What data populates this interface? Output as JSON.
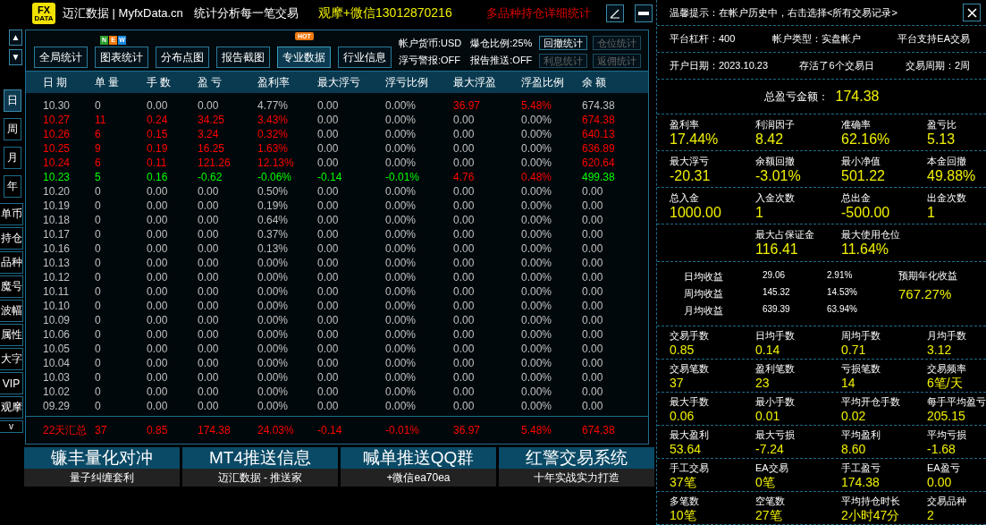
{
  "title_bar": {
    "logo_top": "FX",
    "logo_bottom": "DATA",
    "brand": "迈汇数据 | MyfxData.cn",
    "slogan": "统计分析每一笔交易",
    "contact": "观摩+微信13012870216",
    "promo": "多品种持仓详细统计"
  },
  "nav_arrows": [
    "▲",
    "▼"
  ],
  "side_tabs": [
    {
      "label": "日",
      "kind": "period",
      "selected": true
    },
    {
      "label": "周",
      "kind": "period",
      "selected": false
    },
    {
      "label": "月",
      "kind": "period",
      "selected": false
    },
    {
      "label": "年",
      "kind": "period",
      "selected": false
    },
    {
      "label": "单币",
      "kind": "view",
      "selected": false
    },
    {
      "label": "持仓",
      "kind": "view",
      "selected": false
    },
    {
      "label": "品种",
      "kind": "view",
      "selected": false
    },
    {
      "label": "魔号",
      "kind": "view",
      "selected": false
    },
    {
      "label": "波幅",
      "kind": "view",
      "selected": false
    },
    {
      "label": "属性",
      "kind": "view",
      "selected": false
    },
    {
      "label": "大字",
      "kind": "view",
      "selected": false
    },
    {
      "label": "VIP",
      "kind": "view",
      "selected": false
    },
    {
      "label": "观摩",
      "kind": "view",
      "selected": false
    },
    {
      "label": "v",
      "kind": "more",
      "selected": false
    }
  ],
  "toolbar": {
    "buttons": [
      {
        "label": "全局统计",
        "selected": false
      },
      {
        "label": "图表统计",
        "selected": false,
        "badge": {
          "kind": "letters",
          "letters": [
            {
              "text": "N",
              "color": "#2e9e2e"
            },
            {
              "text": "E",
              "color": "#f07a10"
            },
            {
              "text": "W",
              "color": "#1a8ae0"
            }
          ]
        }
      },
      {
        "label": "分布点图",
        "selected": false
      },
      {
        "label": "报告截图",
        "selected": false
      },
      {
        "label": "专业数据",
        "selected": true,
        "badge": {
          "kind": "hot",
          "text": "HOT"
        }
      },
      {
        "label": "行业信息",
        "selected": false
      }
    ],
    "info": [
      "帐户货币:USD",
      "爆仓比例:25%",
      "浮亏警报:OFF",
      "报告推送:OFF"
    ],
    "small_buttons": [
      {
        "label": "回撤统计",
        "disabled": false
      },
      {
        "label": "仓位统计",
        "disabled": true
      },
      {
        "label": "利息统计",
        "disabled": true
      },
      {
        "label": "返佣统计",
        "disabled": true
      }
    ]
  },
  "table": {
    "columns": [
      "日 期",
      "单 量",
      "手 数",
      "盈 亏",
      "盈利率",
      "最大浮亏",
      "浮亏比例",
      "最大浮盈",
      "浮盈比例",
      "余 额"
    ],
    "rows": [
      {
        "cells": [
          {
            "text": "10.30",
            "color": "#c0c0c0"
          },
          {
            "text": "0",
            "color": "#c0c0c0"
          },
          {
            "text": "0.00",
            "color": "#c0c0c0"
          },
          {
            "text": "0.00",
            "color": "#c0c0c0"
          },
          {
            "text": "4.77%",
            "color": "#c0c0c0"
          },
          {
            "text": "0.00",
            "color": "#c0c0c0"
          },
          {
            "text": "0.00%",
            "color": "#c0c0c0"
          },
          {
            "text": "36.97",
            "color": "#ff0000"
          },
          {
            "text": "5.48%",
            "color": "#ff0000"
          },
          {
            "text": "674.38",
            "color": "#c0c0c0"
          }
        ]
      },
      {
        "cells": [
          {
            "text": "10.27",
            "color": "#ff0000"
          },
          {
            "text": "11",
            "color": "#ff0000"
          },
          {
            "text": "0.24",
            "color": "#ff0000"
          },
          {
            "text": "34.25",
            "color": "#ff0000"
          },
          {
            "text": "3.43%",
            "color": "#ff0000"
          },
          {
            "text": "0.00",
            "color": "#c0c0c0"
          },
          {
            "text": "0.00%",
            "color": "#c0c0c0"
          },
          {
            "text": "0.00",
            "color": "#c0c0c0"
          },
          {
            "text": "0.00%",
            "color": "#c0c0c0"
          },
          {
            "text": "674.38",
            "color": "#ff0000"
          }
        ]
      },
      {
        "cells": [
          {
            "text": "10.26",
            "color": "#ff0000"
          },
          {
            "text": "6",
            "color": "#ff0000"
          },
          {
            "text": "0.15",
            "color": "#ff0000"
          },
          {
            "text": "3.24",
            "color": "#ff0000"
          },
          {
            "text": "0.32%",
            "color": "#ff0000"
          },
          {
            "text": "0.00",
            "color": "#c0c0c0"
          },
          {
            "text": "0.00%",
            "color": "#c0c0c0"
          },
          {
            "text": "0.00",
            "color": "#c0c0c0"
          },
          {
            "text": "0.00%",
            "color": "#c0c0c0"
          },
          {
            "text": "640.13",
            "color": "#ff0000"
          }
        ]
      },
      {
        "cells": [
          {
            "text": "10.25",
            "color": "#ff0000"
          },
          {
            "text": "9",
            "color": "#ff0000"
          },
          {
            "text": "0.19",
            "color": "#ff0000"
          },
          {
            "text": "16.25",
            "color": "#ff0000"
          },
          {
            "text": "1.63%",
            "color": "#ff0000"
          },
          {
            "text": "0.00",
            "color": "#c0c0c0"
          },
          {
            "text": "0.00%",
            "color": "#c0c0c0"
          },
          {
            "text": "0.00",
            "color": "#c0c0c0"
          },
          {
            "text": "0.00%",
            "color": "#c0c0c0"
          },
          {
            "text": "636.89",
            "color": "#ff0000"
          }
        ]
      },
      {
        "cells": [
          {
            "text": "10.24",
            "color": "#ff0000"
          },
          {
            "text": "6",
            "color": "#ff0000"
          },
          {
            "text": "0.11",
            "color": "#ff0000"
          },
          {
            "text": "121.26",
            "color": "#ff0000"
          },
          {
            "text": "12.13%",
            "color": "#ff0000"
          },
          {
            "text": "0.00",
            "color": "#c0c0c0"
          },
          {
            "text": "0.00%",
            "color": "#c0c0c0"
          },
          {
            "text": "0.00",
            "color": "#c0c0c0"
          },
          {
            "text": "0.00%",
            "color": "#c0c0c0"
          },
          {
            "text": "620.64",
            "color": "#ff0000"
          }
        ]
      },
      {
        "cells": [
          {
            "text": "10.23",
            "color": "#00ff00"
          },
          {
            "text": "5",
            "color": "#00ff00"
          },
          {
            "text": "0.16",
            "color": "#00ff00"
          },
          {
            "text": "-0.62",
            "color": "#00ff00"
          },
          {
            "text": "-0.06%",
            "color": "#00ff00"
          },
          {
            "text": "-0.14",
            "color": "#00ff00"
          },
          {
            "text": "-0.01%",
            "color": "#00ff00"
          },
          {
            "text": "4.76",
            "color": "#ff0000"
          },
          {
            "text": "0.48%",
            "color": "#ff0000"
          },
          {
            "text": "499.38",
            "color": "#00ff00"
          }
        ]
      },
      {
        "cells": [
          {
            "text": "10.20",
            "color": "#c0c0c0"
          },
          {
            "text": "0",
            "color": "#c0c0c0"
          },
          {
            "text": "0.00",
            "color": "#c0c0c0"
          },
          {
            "text": "0.00",
            "color": "#c0c0c0"
          },
          {
            "text": "0.50%",
            "color": "#c0c0c0"
          },
          {
            "text": "0.00",
            "color": "#c0c0c0"
          },
          {
            "text": "0.00%",
            "color": "#c0c0c0"
          },
          {
            "text": "0.00",
            "color": "#c0c0c0"
          },
          {
            "text": "0.00%",
            "color": "#c0c0c0"
          },
          {
            "text": "0.00",
            "color": "#c0c0c0"
          }
        ]
      },
      {
        "cells": [
          {
            "text": "10.19",
            "color": "#c0c0c0"
          },
          {
            "text": "0",
            "color": "#c0c0c0"
          },
          {
            "text": "0.00",
            "color": "#c0c0c0"
          },
          {
            "text": "0.00",
            "color": "#c0c0c0"
          },
          {
            "text": "0.19%",
            "color": "#c0c0c0"
          },
          {
            "text": "0.00",
            "color": "#c0c0c0"
          },
          {
            "text": "0.00%",
            "color": "#c0c0c0"
          },
          {
            "text": "0.00",
            "color": "#c0c0c0"
          },
          {
            "text": "0.00%",
            "color": "#c0c0c0"
          },
          {
            "text": "0.00",
            "color": "#c0c0c0"
          }
        ]
      },
      {
        "cells": [
          {
            "text": "10.18",
            "color": "#c0c0c0"
          },
          {
            "text": "0",
            "color": "#c0c0c0"
          },
          {
            "text": "0.00",
            "color": "#c0c0c0"
          },
          {
            "text": "0.00",
            "color": "#c0c0c0"
          },
          {
            "text": "0.64%",
            "color": "#c0c0c0"
          },
          {
            "text": "0.00",
            "color": "#c0c0c0"
          },
          {
            "text": "0.00%",
            "color": "#c0c0c0"
          },
          {
            "text": "0.00",
            "color": "#c0c0c0"
          },
          {
            "text": "0.00%",
            "color": "#c0c0c0"
          },
          {
            "text": "0.00",
            "color": "#c0c0c0"
          }
        ]
      },
      {
        "cells": [
          {
            "text": "10.17",
            "color": "#c0c0c0"
          },
          {
            "text": "0",
            "color": "#c0c0c0"
          },
          {
            "text": "0.00",
            "color": "#c0c0c0"
          },
          {
            "text": "0.00",
            "color": "#c0c0c0"
          },
          {
            "text": "0.37%",
            "color": "#c0c0c0"
          },
          {
            "text": "0.00",
            "color": "#c0c0c0"
          },
          {
            "text": "0.00%",
            "color": "#c0c0c0"
          },
          {
            "text": "0.00",
            "color": "#c0c0c0"
          },
          {
            "text": "0.00%",
            "color": "#c0c0c0"
          },
          {
            "text": "0.00",
            "color": "#c0c0c0"
          }
        ]
      },
      {
        "cells": [
          {
            "text": "10.16",
            "color": "#c0c0c0"
          },
          {
            "text": "0",
            "color": "#c0c0c0"
          },
          {
            "text": "0.00",
            "color": "#c0c0c0"
          },
          {
            "text": "0.00",
            "color": "#c0c0c0"
          },
          {
            "text": "0.13%",
            "color": "#c0c0c0"
          },
          {
            "text": "0.00",
            "color": "#c0c0c0"
          },
          {
            "text": "0.00%",
            "color": "#c0c0c0"
          },
          {
            "text": "0.00",
            "color": "#c0c0c0"
          },
          {
            "text": "0.00%",
            "color": "#c0c0c0"
          },
          {
            "text": "0.00",
            "color": "#c0c0c0"
          }
        ]
      },
      {
        "cells": [
          {
            "text": "10.13",
            "color": "#c0c0c0"
          },
          {
            "text": "0",
            "color": "#c0c0c0"
          },
          {
            "text": "0.00",
            "color": "#c0c0c0"
          },
          {
            "text": "0.00",
            "color": "#c0c0c0"
          },
          {
            "text": "0.00%",
            "color": "#c0c0c0"
          },
          {
            "text": "0.00",
            "color": "#c0c0c0"
          },
          {
            "text": "0.00%",
            "color": "#c0c0c0"
          },
          {
            "text": "0.00",
            "color": "#c0c0c0"
          },
          {
            "text": "0.00%",
            "color": "#c0c0c0"
          },
          {
            "text": "0.00",
            "color": "#c0c0c0"
          }
        ]
      },
      {
        "cells": [
          {
            "text": "10.12",
            "color": "#c0c0c0"
          },
          {
            "text": "0",
            "color": "#c0c0c0"
          },
          {
            "text": "0.00",
            "color": "#c0c0c0"
          },
          {
            "text": "0.00",
            "color": "#c0c0c0"
          },
          {
            "text": "0.00%",
            "color": "#c0c0c0"
          },
          {
            "text": "0.00",
            "color": "#c0c0c0"
          },
          {
            "text": "0.00%",
            "color": "#c0c0c0"
          },
          {
            "text": "0.00",
            "color": "#c0c0c0"
          },
          {
            "text": "0.00%",
            "color": "#c0c0c0"
          },
          {
            "text": "0.00",
            "color": "#c0c0c0"
          }
        ]
      },
      {
        "cells": [
          {
            "text": "10.11",
            "color": "#c0c0c0"
          },
          {
            "text": "0",
            "color": "#c0c0c0"
          },
          {
            "text": "0.00",
            "color": "#c0c0c0"
          },
          {
            "text": "0.00",
            "color": "#c0c0c0"
          },
          {
            "text": "0.00%",
            "color": "#c0c0c0"
          },
          {
            "text": "0.00",
            "color": "#c0c0c0"
          },
          {
            "text": "0.00%",
            "color": "#c0c0c0"
          },
          {
            "text": "0.00",
            "color": "#c0c0c0"
          },
          {
            "text": "0.00%",
            "color": "#c0c0c0"
          },
          {
            "text": "0.00",
            "color": "#c0c0c0"
          }
        ]
      },
      {
        "cells": [
          {
            "text": "10.10",
            "color": "#c0c0c0"
          },
          {
            "text": "0",
            "color": "#c0c0c0"
          },
          {
            "text": "0.00",
            "color": "#c0c0c0"
          },
          {
            "text": "0.00",
            "color": "#c0c0c0"
          },
          {
            "text": "0.00%",
            "color": "#c0c0c0"
          },
          {
            "text": "0.00",
            "color": "#c0c0c0"
          },
          {
            "text": "0.00%",
            "color": "#c0c0c0"
          },
          {
            "text": "0.00",
            "color": "#c0c0c0"
          },
          {
            "text": "0.00%",
            "color": "#c0c0c0"
          },
          {
            "text": "0.00",
            "color": "#c0c0c0"
          }
        ]
      },
      {
        "cells": [
          {
            "text": "10.09",
            "color": "#c0c0c0"
          },
          {
            "text": "0",
            "color": "#c0c0c0"
          },
          {
            "text": "0.00",
            "color": "#c0c0c0"
          },
          {
            "text": "0.00",
            "color": "#c0c0c0"
          },
          {
            "text": "0.00%",
            "color": "#c0c0c0"
          },
          {
            "text": "0.00",
            "color": "#c0c0c0"
          },
          {
            "text": "0.00%",
            "color": "#c0c0c0"
          },
          {
            "text": "0.00",
            "color": "#c0c0c0"
          },
          {
            "text": "0.00%",
            "color": "#c0c0c0"
          },
          {
            "text": "0.00",
            "color": "#c0c0c0"
          }
        ]
      },
      {
        "cells": [
          {
            "text": "10.06",
            "color": "#c0c0c0"
          },
          {
            "text": "0",
            "color": "#c0c0c0"
          },
          {
            "text": "0.00",
            "color": "#c0c0c0"
          },
          {
            "text": "0.00",
            "color": "#c0c0c0"
          },
          {
            "text": "0.00%",
            "color": "#c0c0c0"
          },
          {
            "text": "0.00",
            "color": "#c0c0c0"
          },
          {
            "text": "0.00%",
            "color": "#c0c0c0"
          },
          {
            "text": "0.00",
            "color": "#c0c0c0"
          },
          {
            "text": "0.00%",
            "color": "#c0c0c0"
          },
          {
            "text": "0.00",
            "color": "#c0c0c0"
          }
        ]
      },
      {
        "cells": [
          {
            "text": "10.05",
            "color": "#c0c0c0"
          },
          {
            "text": "0",
            "color": "#c0c0c0"
          },
          {
            "text": "0.00",
            "color": "#c0c0c0"
          },
          {
            "text": "0.00",
            "color": "#c0c0c0"
          },
          {
            "text": "0.00%",
            "color": "#c0c0c0"
          },
          {
            "text": "0.00",
            "color": "#c0c0c0"
          },
          {
            "text": "0.00%",
            "color": "#c0c0c0"
          },
          {
            "text": "0.00",
            "color": "#c0c0c0"
          },
          {
            "text": "0.00%",
            "color": "#c0c0c0"
          },
          {
            "text": "0.00",
            "color": "#c0c0c0"
          }
        ]
      },
      {
        "cells": [
          {
            "text": "10.04",
            "color": "#c0c0c0"
          },
          {
            "text": "0",
            "color": "#c0c0c0"
          },
          {
            "text": "0.00",
            "color": "#c0c0c0"
          },
          {
            "text": "0.00",
            "color": "#c0c0c0"
          },
          {
            "text": "0.00%",
            "color": "#c0c0c0"
          },
          {
            "text": "0.00",
            "color": "#c0c0c0"
          },
          {
            "text": "0.00%",
            "color": "#c0c0c0"
          },
          {
            "text": "0.00",
            "color": "#c0c0c0"
          },
          {
            "text": "0.00%",
            "color": "#c0c0c0"
          },
          {
            "text": "0.00",
            "color": "#c0c0c0"
          }
        ]
      },
      {
        "cells": [
          {
            "text": "10.03",
            "color": "#c0c0c0"
          },
          {
            "text": "0",
            "color": "#c0c0c0"
          },
          {
            "text": "0.00",
            "color": "#c0c0c0"
          },
          {
            "text": "0.00",
            "color": "#c0c0c0"
          },
          {
            "text": "0.00%",
            "color": "#c0c0c0"
          },
          {
            "text": "0.00",
            "color": "#c0c0c0"
          },
          {
            "text": "0.00%",
            "color": "#c0c0c0"
          },
          {
            "text": "0.00",
            "color": "#c0c0c0"
          },
          {
            "text": "0.00%",
            "color": "#c0c0c0"
          },
          {
            "text": "0.00",
            "color": "#c0c0c0"
          }
        ]
      },
      {
        "cells": [
          {
            "text": "10.02",
            "color": "#c0c0c0"
          },
          {
            "text": "0",
            "color": "#c0c0c0"
          },
          {
            "text": "0.00",
            "color": "#c0c0c0"
          },
          {
            "text": "0.00",
            "color": "#c0c0c0"
          },
          {
            "text": "0.00%",
            "color": "#c0c0c0"
          },
          {
            "text": "0.00",
            "color": "#c0c0c0"
          },
          {
            "text": "0.00%",
            "color": "#c0c0c0"
          },
          {
            "text": "0.00",
            "color": "#c0c0c0"
          },
          {
            "text": "0.00%",
            "color": "#c0c0c0"
          },
          {
            "text": "0.00",
            "color": "#c0c0c0"
          }
        ]
      },
      {
        "cells": [
          {
            "text": "09.29",
            "color": "#c0c0c0"
          },
          {
            "text": "0",
            "color": "#c0c0c0"
          },
          {
            "text": "0.00",
            "color": "#c0c0c0"
          },
          {
            "text": "0.00",
            "color": "#c0c0c0"
          },
          {
            "text": "0.00%",
            "color": "#c0c0c0"
          },
          {
            "text": "0.00",
            "color": "#c0c0c0"
          },
          {
            "text": "0.00%",
            "color": "#c0c0c0"
          },
          {
            "text": "0.00",
            "color": "#c0c0c0"
          },
          {
            "text": "0.00%",
            "color": "#c0c0c0"
          },
          {
            "text": "0.00",
            "color": "#c0c0c0"
          }
        ]
      }
    ],
    "summary": {
      "cells": [
        "22天汇总",
        "37",
        "0.85",
        "174.38",
        "24.03%",
        "-0.14",
        "-0.01%",
        "36.97",
        "5.48%",
        "674.38"
      ],
      "color": "#ff0000"
    }
  },
  "banners": [
    {
      "title": "镰丰量化对冲",
      "subtitle": "量子纠缠套利"
    },
    {
      "title": "MT4推送信息",
      "subtitle": "迈汇数据 - 推送家"
    },
    {
      "title": "喊单推送QQ群",
      "subtitle": "+微信ea70ea"
    },
    {
      "title": "红警交易系统",
      "subtitle": "十年实战实力打造"
    }
  ],
  "panel": {
    "tip": "温馨提示：在帐户历史中，右击选择<所有交易记录>",
    "info_rows": [
      [
        "平台杠杆：400",
        "帐户类型：实盘帐户",
        "平台支持EA交易"
      ],
      [
        "开户日期：2023.10.23",
        "存活了6个交易日",
        "交易周期：2周"
      ]
    ],
    "total": {
      "label": "总盈亏金额：",
      "value": "174.38"
    },
    "big_groups": [
      [
        {
          "label": "盈利率",
          "value": "17.44%"
        },
        {
          "label": "利润因子",
          "value": "8.42"
        },
        {
          "label": "准确率",
          "value": "62.16%"
        },
        {
          "label": "盈亏比",
          "value": "5.13"
        }
      ],
      [
        {
          "label": "最大浮亏",
          "value": "-20.31"
        },
        {
          "label": "余额回撤",
          "value": "-3.01%"
        },
        {
          "label": "最小净值",
          "value": "501.22"
        },
        {
          "label": "本金回撤",
          "value": "49.88%"
        }
      ],
      [
        {
          "label": "总入金",
          "value": "1000.00"
        },
        {
          "label": "入金次数",
          "value": "1"
        },
        {
          "label": "总出金",
          "value": "-500.00"
        },
        {
          "label": "出金次数",
          "value": "1"
        }
      ]
    ],
    "margin_group": [
      {
        "label": "最大占保证金",
        "value": "116.41"
      },
      {
        "label": "最大使用仓位",
        "value": "11.64%"
      }
    ],
    "averages": {
      "rows": [
        {
          "label": "日均收益",
          "amount": "29.06",
          "percent": "2.91%"
        },
        {
          "label": "周均收益",
          "amount": "145.32",
          "percent": "14.53%"
        },
        {
          "label": "月均收益",
          "amount": "639.39",
          "percent": "63.94%"
        }
      ],
      "annual": {
        "label": "预期年化收益",
        "value": "767.27%"
      }
    },
    "groups": [
      [
        {
          "label": "交易手数",
          "value": "0.85"
        },
        {
          "label": "日均手数",
          "value": "0.14"
        },
        {
          "label": "周均手数",
          "value": "0.71"
        },
        {
          "label": "月均手数",
          "value": "3.12"
        }
      ],
      [
        {
          "label": "交易笔数",
          "value": "37"
        },
        {
          "label": "盈利笔数",
          "value": "23"
        },
        {
          "label": "亏损笔数",
          "value": "14"
        },
        {
          "label": "交易频率",
          "value": "6笔/天"
        }
      ],
      [
        {
          "label": "最大手数",
          "value": "0.06"
        },
        {
          "label": "最小手数",
          "value": "0.01"
        },
        {
          "label": "平均开仓手数",
          "value": "0.02"
        },
        {
          "label": "每手平均盈亏",
          "value": "205.15"
        }
      ],
      [
        {
          "label": "最大盈利",
          "value": "53.64"
        },
        {
          "label": "最大亏损",
          "value": "-7.24"
        },
        {
          "label": "平均盈利",
          "value": "8.60"
        },
        {
          "label": "平均亏损",
          "value": "-1.68"
        }
      ],
      [
        {
          "label": "手工交易",
          "value": "37笔"
        },
        {
          "label": "EA交易",
          "value": "0笔"
        },
        {
          "label": "手工盈亏",
          "value": "174.38"
        },
        {
          "label": "EA盈亏",
          "value": "0.00"
        }
      ],
      [
        {
          "label": "多笔数",
          "value": "10笔"
        },
        {
          "label": "空笔数",
          "value": "27笔"
        },
        {
          "label": "平均持仓时长",
          "value": "2小时47分"
        },
        {
          "label": "交易品种",
          "value": "2"
        }
      ]
    ]
  }
}
